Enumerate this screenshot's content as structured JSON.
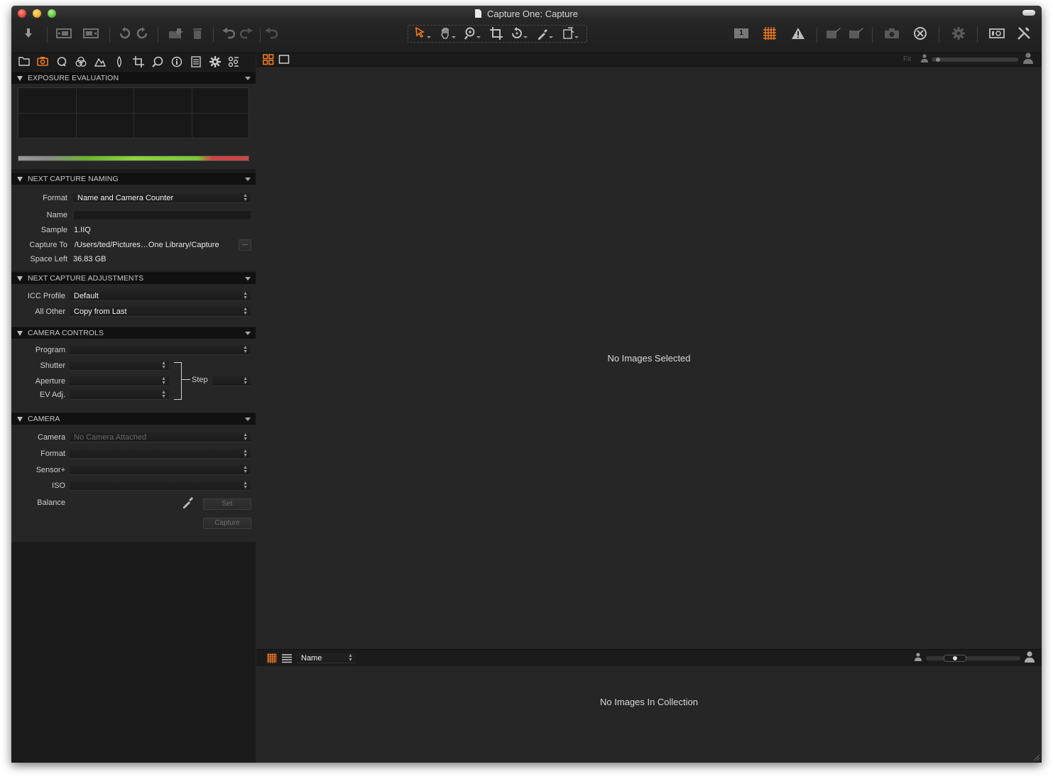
{
  "window": {
    "title": "Capture One: Capture"
  },
  "toolbar": {
    "left_icons": [
      "import-icon",
      "capture-icon",
      "capture-pilot-icon",
      "rotate-left-icon",
      "rotate-right-icon",
      "move-to-folder-icon",
      "trash-icon",
      "undo-icon",
      "redo-icon",
      "reset-icon"
    ],
    "cursor_tools": [
      "select-cursor-icon",
      "pan-icon",
      "zoom-icon",
      "crop-icon",
      "rotate-icon",
      "picker-icon",
      "copy-apply-icon"
    ],
    "right_icons": [
      "single-view-icon",
      "grid-icon",
      "exposure-warning-icon",
      "edit-with-icon",
      "open-with-icon",
      "camera-icon",
      "stop-icon",
      "settings-icon",
      "proof-icon",
      "customize-icon"
    ],
    "single_view_number": "1"
  },
  "tool_tabs": [
    "library-tab",
    "capture-tab",
    "lens-tab",
    "color-tab",
    "exposure-tab",
    "details-tab",
    "crop-tab",
    "local-adjust-tab",
    "metadata-tab",
    "output-tab",
    "settings-tab",
    "batch-tab"
  ],
  "exposure_evaluation": {
    "title": "EXPOSURE EVALUATION"
  },
  "next_capture_naming": {
    "title": "NEXT CAPTURE NAMING",
    "format_label": "Format",
    "format_value": "Name and Camera Counter",
    "name_label": "Name",
    "name_value": "",
    "sample_label": "Sample",
    "sample_value": "1.IIQ",
    "capture_to_label": "Capture To",
    "capture_to_value": "/Users/ted/Pictures…One Library/Capture",
    "browse_button": "...",
    "space_left_label": "Space Left",
    "space_left_value": "36.83 GB"
  },
  "next_capture_adjustments": {
    "title": "NEXT CAPTURE ADJUSTMENTS",
    "icc_label": "ICC Profile",
    "icc_value": "Default",
    "all_other_label": "All Other",
    "all_other_value": "Copy from Last"
  },
  "camera_controls": {
    "title": "CAMERA CONTROLS",
    "program_label": "Program",
    "shutter_label": "Shutter",
    "aperture_label": "Aperture",
    "ev_label": "EV Adj.",
    "step_label": "Step"
  },
  "camera": {
    "title": "CAMERA",
    "camera_label": "Camera",
    "camera_value": "No Camera Attached",
    "format_label": "Format",
    "sensor_label": "Sensor+",
    "iso_label": "ISO",
    "balance_label": "Balance",
    "set_button": "Set",
    "capture_button": "Capture"
  },
  "viewer": {
    "fit_label": "Fit",
    "message": "No Images Selected",
    "zoom_level": 0.05
  },
  "browser": {
    "sort_value": "Name",
    "message": "No Images In Collection",
    "thumb_size": 0.3
  },
  "colors": {
    "accent": "#f07a22",
    "background": "#262626",
    "panel": "#1b1b1b"
  }
}
